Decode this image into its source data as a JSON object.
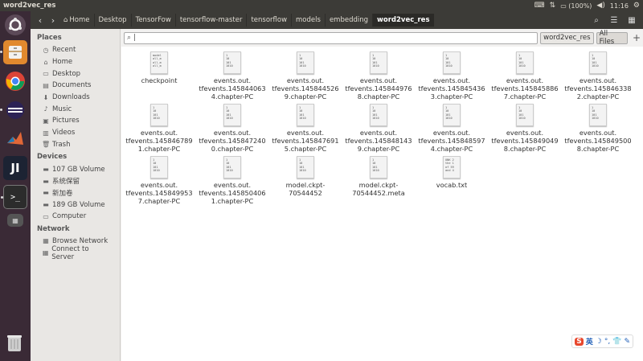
{
  "window": {
    "title": "word2vec_res"
  },
  "tray": {
    "battery": "(100%)",
    "time": "11:16"
  },
  "breadcrumbs": [
    "Home",
    "Desktop",
    "TensorFow",
    "tensorflow-master",
    "tensorflow",
    "models",
    "embedding",
    "word2vec_res"
  ],
  "sidebar": {
    "places_header": "Places",
    "places": [
      {
        "label": "Recent",
        "icon": "clock-icon"
      },
      {
        "label": "Home",
        "icon": "home-icon"
      },
      {
        "label": "Desktop",
        "icon": "folder-icon"
      },
      {
        "label": "Documents",
        "icon": "document-icon"
      },
      {
        "label": "Downloads",
        "icon": "download-icon"
      },
      {
        "label": "Music",
        "icon": "music-icon"
      },
      {
        "label": "Pictures",
        "icon": "picture-icon"
      },
      {
        "label": "Videos",
        "icon": "video-icon"
      },
      {
        "label": "Trash",
        "icon": "trash-icon"
      }
    ],
    "devices_header": "Devices",
    "devices": [
      {
        "label": "107 GB Volume",
        "icon": "drive-icon"
      },
      {
        "label": "系统保留",
        "icon": "drive-icon"
      },
      {
        "label": "新加卷",
        "icon": "drive-icon"
      },
      {
        "label": "189 GB Volume",
        "icon": "drive-icon"
      },
      {
        "label": "Computer",
        "icon": "computer-icon"
      }
    ],
    "network_header": "Network",
    "network": [
      {
        "label": "Browse Network",
        "icon": "network-icon"
      },
      {
        "label": "Connect to Server",
        "icon": "server-icon"
      }
    ]
  },
  "search": {
    "placeholder": "|",
    "scope_current": "word2vec_res",
    "scope_all": "All Files"
  },
  "files": [
    {
      "name": "checkpoint",
      "thumb": "model\nall_m\nall_m\nall_m"
    },
    {
      "name": "events.out.\ntfevents.145844063\n4.chapter-PC",
      "thumb": "1\n10\n101\n1010"
    },
    {
      "name": "events.out.\ntfevents.145844526\n9.chapter-PC",
      "thumb": "1\n10\n101\n1010"
    },
    {
      "name": "events.out.\ntfevents.145844976\n8.chapter-PC",
      "thumb": "1\n10\n101\n1010"
    },
    {
      "name": "events.out.\ntfevents.145845436\n3.chapter-PC",
      "thumb": "1\n10\n101\n1010"
    },
    {
      "name": "events.out.\ntfevents.145845886\n7.chapter-PC",
      "thumb": "1\n10\n101\n1010"
    },
    {
      "name": "events.out.\ntfevents.145846338\n2.chapter-PC",
      "thumb": "1\n10\n101\n1010"
    },
    {
      "name": "events.out.\ntfevents.145846789\n1.chapter-PC",
      "thumb": "1\n10\n101\n1010"
    },
    {
      "name": "events.out.\ntfevents.145847240\n0.chapter-PC",
      "thumb": "1\n10\n101\n1010"
    },
    {
      "name": "events.out.\ntfevents.145847691\n5.chapter-PC",
      "thumb": "1\n10\n101\n1010"
    },
    {
      "name": "events.out.\ntfevents.145848143\n9.chapter-PC",
      "thumb": "1\n10\n101\n1010"
    },
    {
      "name": "events.out.\ntfevents.145848597\n4.chapter-PC",
      "thumb": "1\n10\n101\n1010"
    },
    {
      "name": "events.out.\ntfevents.145849049\n8.chapter-PC",
      "thumb": "1\n10\n101\n1010"
    },
    {
      "name": "events.out.\ntfevents.145849500\n8.chapter-PC",
      "thumb": "1\n10\n101\n1010"
    },
    {
      "name": "events.out.\ntfevents.145849953\n7.chapter-PC",
      "thumb": "1\n10\n101\n1010"
    },
    {
      "name": "events.out.\ntfevents.145850406\n1.chapter-PC",
      "thumb": "1\n10\n101\n1010"
    },
    {
      "name": "model.ckpt-\n70544452",
      "thumb": "1\n10\n101\n1010"
    },
    {
      "name": "model.ckpt-\n70544452.meta",
      "thumb": "1\n10\n101\n1010"
    },
    {
      "name": "vocab.txt",
      "thumb": "UNK 2\nthe 1\nof 59\nand 4"
    }
  ],
  "ime": {
    "label": "英"
  }
}
